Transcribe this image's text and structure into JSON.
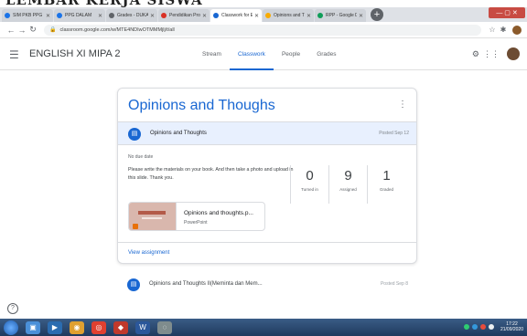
{
  "banner": {
    "text": "LEMBAR KERJA SISWA"
  },
  "browser": {
    "tabs": [
      {
        "label": "SIM PKB PPG Prajal",
        "color": "#1a73e8",
        "active": false
      },
      {
        "label": "PPG DALAM",
        "color": "#1a73e8",
        "active": false
      },
      {
        "label": "Grades - DUKA Wi",
        "color": "#5f6368",
        "active": false
      },
      {
        "label": "Pendidikan Profesi",
        "color": "#d93025",
        "active": false
      },
      {
        "label": "Classwork for ENG",
        "color": "#1967d2",
        "active": true
      },
      {
        "label": "Opinions and Thou",
        "color": "#f9ab00",
        "active": false
      },
      {
        "label": "RPP - Google Drive",
        "color": "#0f9d58",
        "active": false
      }
    ],
    "new_tab": "+",
    "url": "classroom.google.com/w/MTE4NDIwOTMMMjlj/t/all"
  },
  "classroom": {
    "class_name": "ENGLISH XI MIPA 2",
    "nav": [
      "Stream",
      "Classwork",
      "People",
      "Grades"
    ],
    "active_nav": "Classwork"
  },
  "topic": {
    "title": "Opinions and Thoughs",
    "assignment": {
      "title": "Opinions and Thoughts",
      "posted": "Posted Sep 12",
      "due": "No due date",
      "instructions": "Please write the materials on your book. And then take a photo and upload in this slide. Thank you.",
      "stats": [
        {
          "value": "0",
          "label": "Turned in"
        },
        {
          "value": "9",
          "label": "Assigned"
        },
        {
          "value": "1",
          "label": "Graded"
        }
      ],
      "attachment": {
        "name": "Opinions and thoughts.p...",
        "type": "PowerPoint"
      },
      "view_label": "View assignment"
    }
  },
  "next_item": {
    "title": "Opinions and Thoughts II(Meminta dan Mem...",
    "posted": "Posted Sep 8"
  },
  "help_label": "?",
  "taskbar": {
    "clock_time": "17:22",
    "clock_date": "21/09/2020"
  }
}
